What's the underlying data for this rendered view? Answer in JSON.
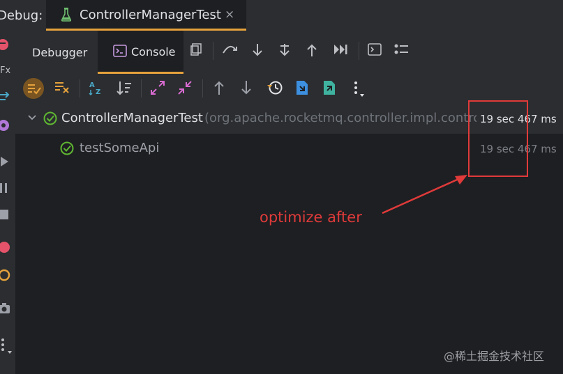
{
  "header": {
    "debug_label": "Debug:",
    "run_tab_title": "ControllerManagerTest",
    "run_tab_close": "×"
  },
  "tabs": [
    {
      "label": "Debugger"
    },
    {
      "label": "Console",
      "active": true
    }
  ],
  "tree": {
    "rows": [
      {
        "name": "ControllerManagerTest",
        "package": "(org.apache.rocketmq.controller.impl.controll",
        "time": "19 sec 467 ms",
        "status": "passed",
        "expanded": true
      },
      {
        "name": "testSomeApi",
        "time": "19 sec 467 ms",
        "status": "passed"
      }
    ]
  },
  "annotation": {
    "text": "optimize after",
    "color": "#e03a3a"
  },
  "watermark": "@稀土掘金技术社区",
  "colors": {
    "accent": "#e6a23c",
    "pass": "#5fb832",
    "annotation": "#e03a3a"
  }
}
